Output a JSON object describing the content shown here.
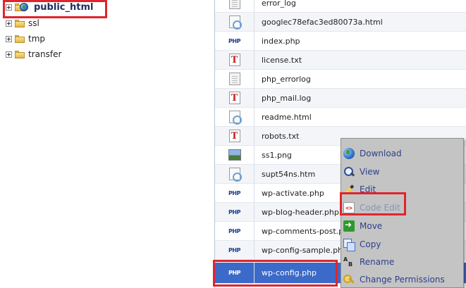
{
  "tree": {
    "items": [
      {
        "label": "public_html",
        "icon": "globe-folder-icon",
        "bold": true
      },
      {
        "label": "ssl",
        "icon": "folder-icon"
      },
      {
        "label": "tmp",
        "icon": "folder-icon"
      },
      {
        "label": "transfer",
        "icon": "folder-icon"
      }
    ]
  },
  "files": {
    "rows": [
      {
        "name": "error_log",
        "icon": "blank-file-icon"
      },
      {
        "name": "googlec78efac3ed80073a.html",
        "icon": "html-file-icon"
      },
      {
        "name": "index.php",
        "icon": "php-file-icon"
      },
      {
        "name": "license.txt",
        "icon": "text-file-icon"
      },
      {
        "name": "php_errorlog",
        "icon": "blank-file-icon"
      },
      {
        "name": "php_mail.log",
        "icon": "text-file-icon"
      },
      {
        "name": "readme.html",
        "icon": "html-file-icon"
      },
      {
        "name": "robots.txt",
        "icon": "text-file-icon"
      },
      {
        "name": "ss1.png",
        "icon": "image-file-icon"
      },
      {
        "name": "supt54ns.htm",
        "icon": "html-file-icon"
      },
      {
        "name": "wp-activate.php",
        "icon": "php-file-icon"
      },
      {
        "name": "wp-blog-header.php",
        "icon": "php-file-icon"
      },
      {
        "name": "wp-comments-post.php",
        "icon": "php-file-icon"
      },
      {
        "name": "wp-config-sample.php",
        "icon": "php-file-icon"
      },
      {
        "name": "wp-config.php",
        "icon": "php-file-icon",
        "selected": true
      }
    ],
    "php_glyph": "PHP",
    "txt_glyph": "T"
  },
  "context_menu": {
    "items": [
      {
        "label": "Download",
        "icon": "download-globe-icon"
      },
      {
        "label": "View",
        "icon": "magnifier-icon"
      },
      {
        "label": "Edit",
        "icon": "pencil-icon"
      },
      {
        "label": "Code Edit",
        "icon": "code-edit-icon",
        "disabled": true
      },
      {
        "label": "Move",
        "icon": "move-arrow-icon"
      },
      {
        "label": "Copy",
        "icon": "copy-pages-icon"
      },
      {
        "label": "Rename",
        "icon": "rename-ab-icon"
      },
      {
        "label": "Change Permissions",
        "icon": "key-icon"
      }
    ],
    "code_glyph": "<>",
    "rename_glyph_a": "A",
    "rename_glyph_b": "B"
  },
  "colors": {
    "selected_row": "#3c6ac8",
    "highlight": "#e0242c",
    "menu_bg": "#c4c4c4",
    "menu_text": "#2e3f8a"
  }
}
